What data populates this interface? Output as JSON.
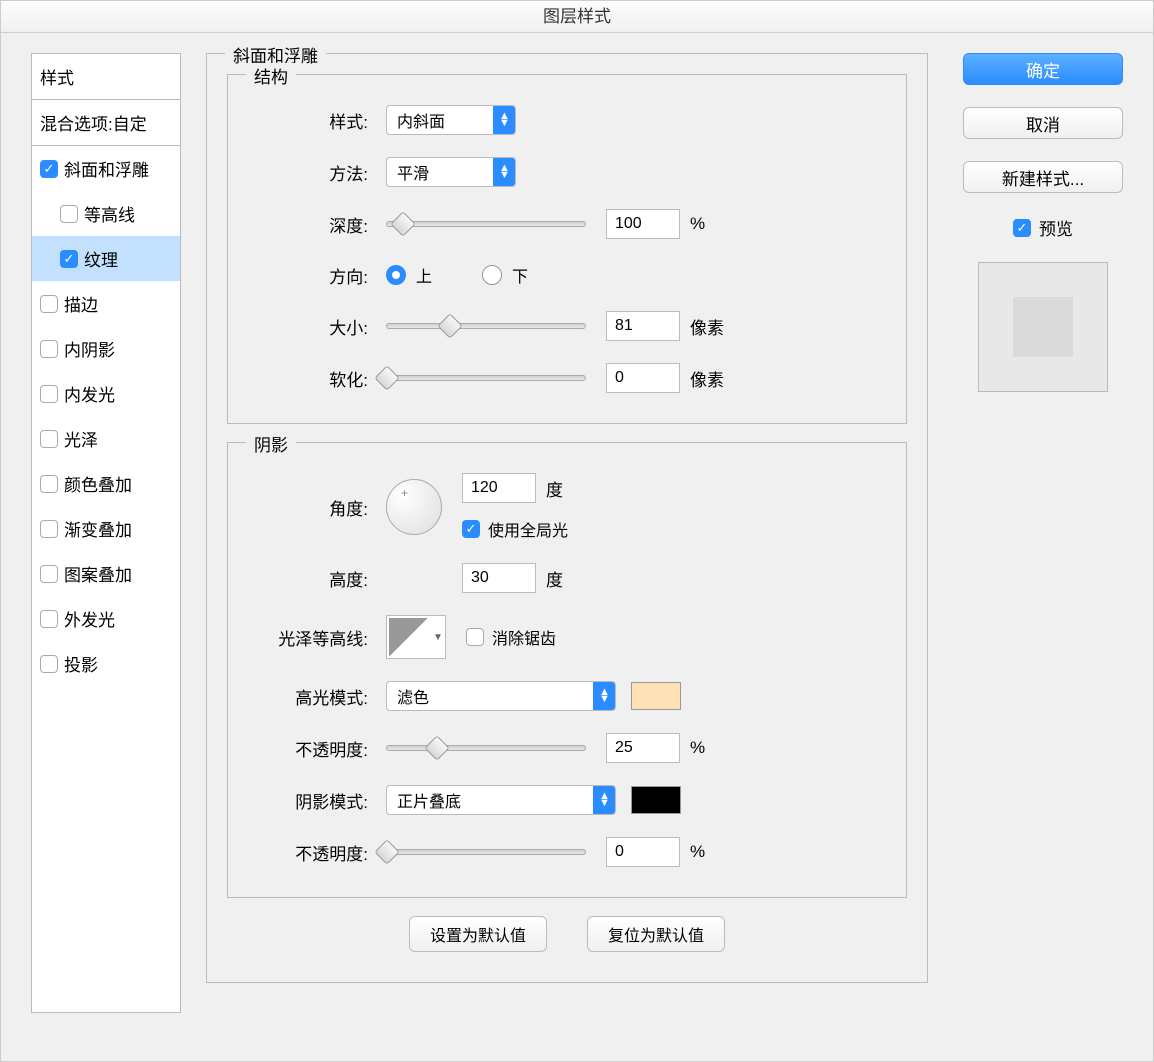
{
  "title": "图层样式",
  "sidebar": {
    "header": "样式",
    "blend": "混合选项:自定",
    "items": [
      {
        "label": "斜面和浮雕",
        "checked": true,
        "indent": false
      },
      {
        "label": "等高线",
        "checked": false,
        "indent": true
      },
      {
        "label": "纹理",
        "checked": true,
        "indent": true,
        "selected": true
      },
      {
        "label": "描边",
        "checked": false,
        "indent": false
      },
      {
        "label": "内阴影",
        "checked": false,
        "indent": false
      },
      {
        "label": "内发光",
        "checked": false,
        "indent": false
      },
      {
        "label": "光泽",
        "checked": false,
        "indent": false
      },
      {
        "label": "颜色叠加",
        "checked": false,
        "indent": false
      },
      {
        "label": "渐变叠加",
        "checked": false,
        "indent": false
      },
      {
        "label": "图案叠加",
        "checked": false,
        "indent": false
      },
      {
        "label": "外发光",
        "checked": false,
        "indent": false
      },
      {
        "label": "投影",
        "checked": false,
        "indent": false
      }
    ]
  },
  "bevel": {
    "title": "斜面和浮雕",
    "structure": {
      "title": "结构",
      "style_label": "样式:",
      "style_value": "内斜面",
      "technique_label": "方法:",
      "technique_value": "平滑",
      "depth_label": "深度:",
      "depth_value": "100",
      "depth_unit": "%",
      "direction_label": "方向:",
      "direction_up": "上",
      "direction_down": "下",
      "size_label": "大小:",
      "size_value": "81",
      "size_unit": "像素",
      "soften_label": "软化:",
      "soften_value": "0",
      "soften_unit": "像素"
    },
    "shading": {
      "title": "阴影",
      "angle_label": "角度:",
      "angle_value": "120",
      "angle_unit": "度",
      "global_light": "使用全局光",
      "altitude_label": "高度:",
      "altitude_value": "30",
      "altitude_unit": "度",
      "gloss_label": "光泽等高线:",
      "antialias": "消除锯齿",
      "highlight_mode_label": "高光模式:",
      "highlight_mode_value": "滤色",
      "highlight_color": "#ffe1b8",
      "highlight_opacity_label": "不透明度:",
      "highlight_opacity_value": "25",
      "highlight_opacity_unit": "%",
      "shadow_mode_label": "阴影模式:",
      "shadow_mode_value": "正片叠底",
      "shadow_color": "#000000",
      "shadow_opacity_label": "不透明度:",
      "shadow_opacity_value": "0",
      "shadow_opacity_unit": "%"
    },
    "make_default": "设置为默认值",
    "reset_default": "复位为默认值"
  },
  "buttons": {
    "ok": "确定",
    "cancel": "取消",
    "new_style": "新建样式...",
    "preview": "预览"
  }
}
